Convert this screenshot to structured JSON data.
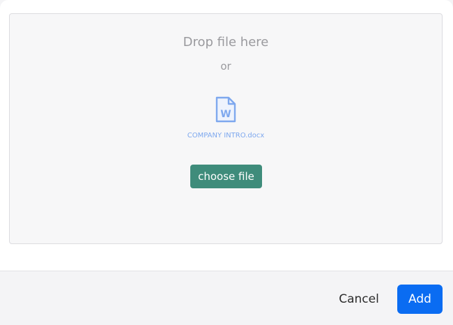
{
  "dropzone": {
    "title": "Drop file here",
    "or_text": "or",
    "file_icon": "word-document-icon",
    "file_icon_letter": "W",
    "file_name": "COMPANY INTRO.docx",
    "choose_label": "choose file"
  },
  "footer": {
    "cancel_label": "Cancel",
    "add_label": "Add"
  },
  "colors": {
    "choose_button": "#3f8c7b",
    "add_button": "#0a6cf2",
    "file_icon": "#7ea8ee"
  }
}
